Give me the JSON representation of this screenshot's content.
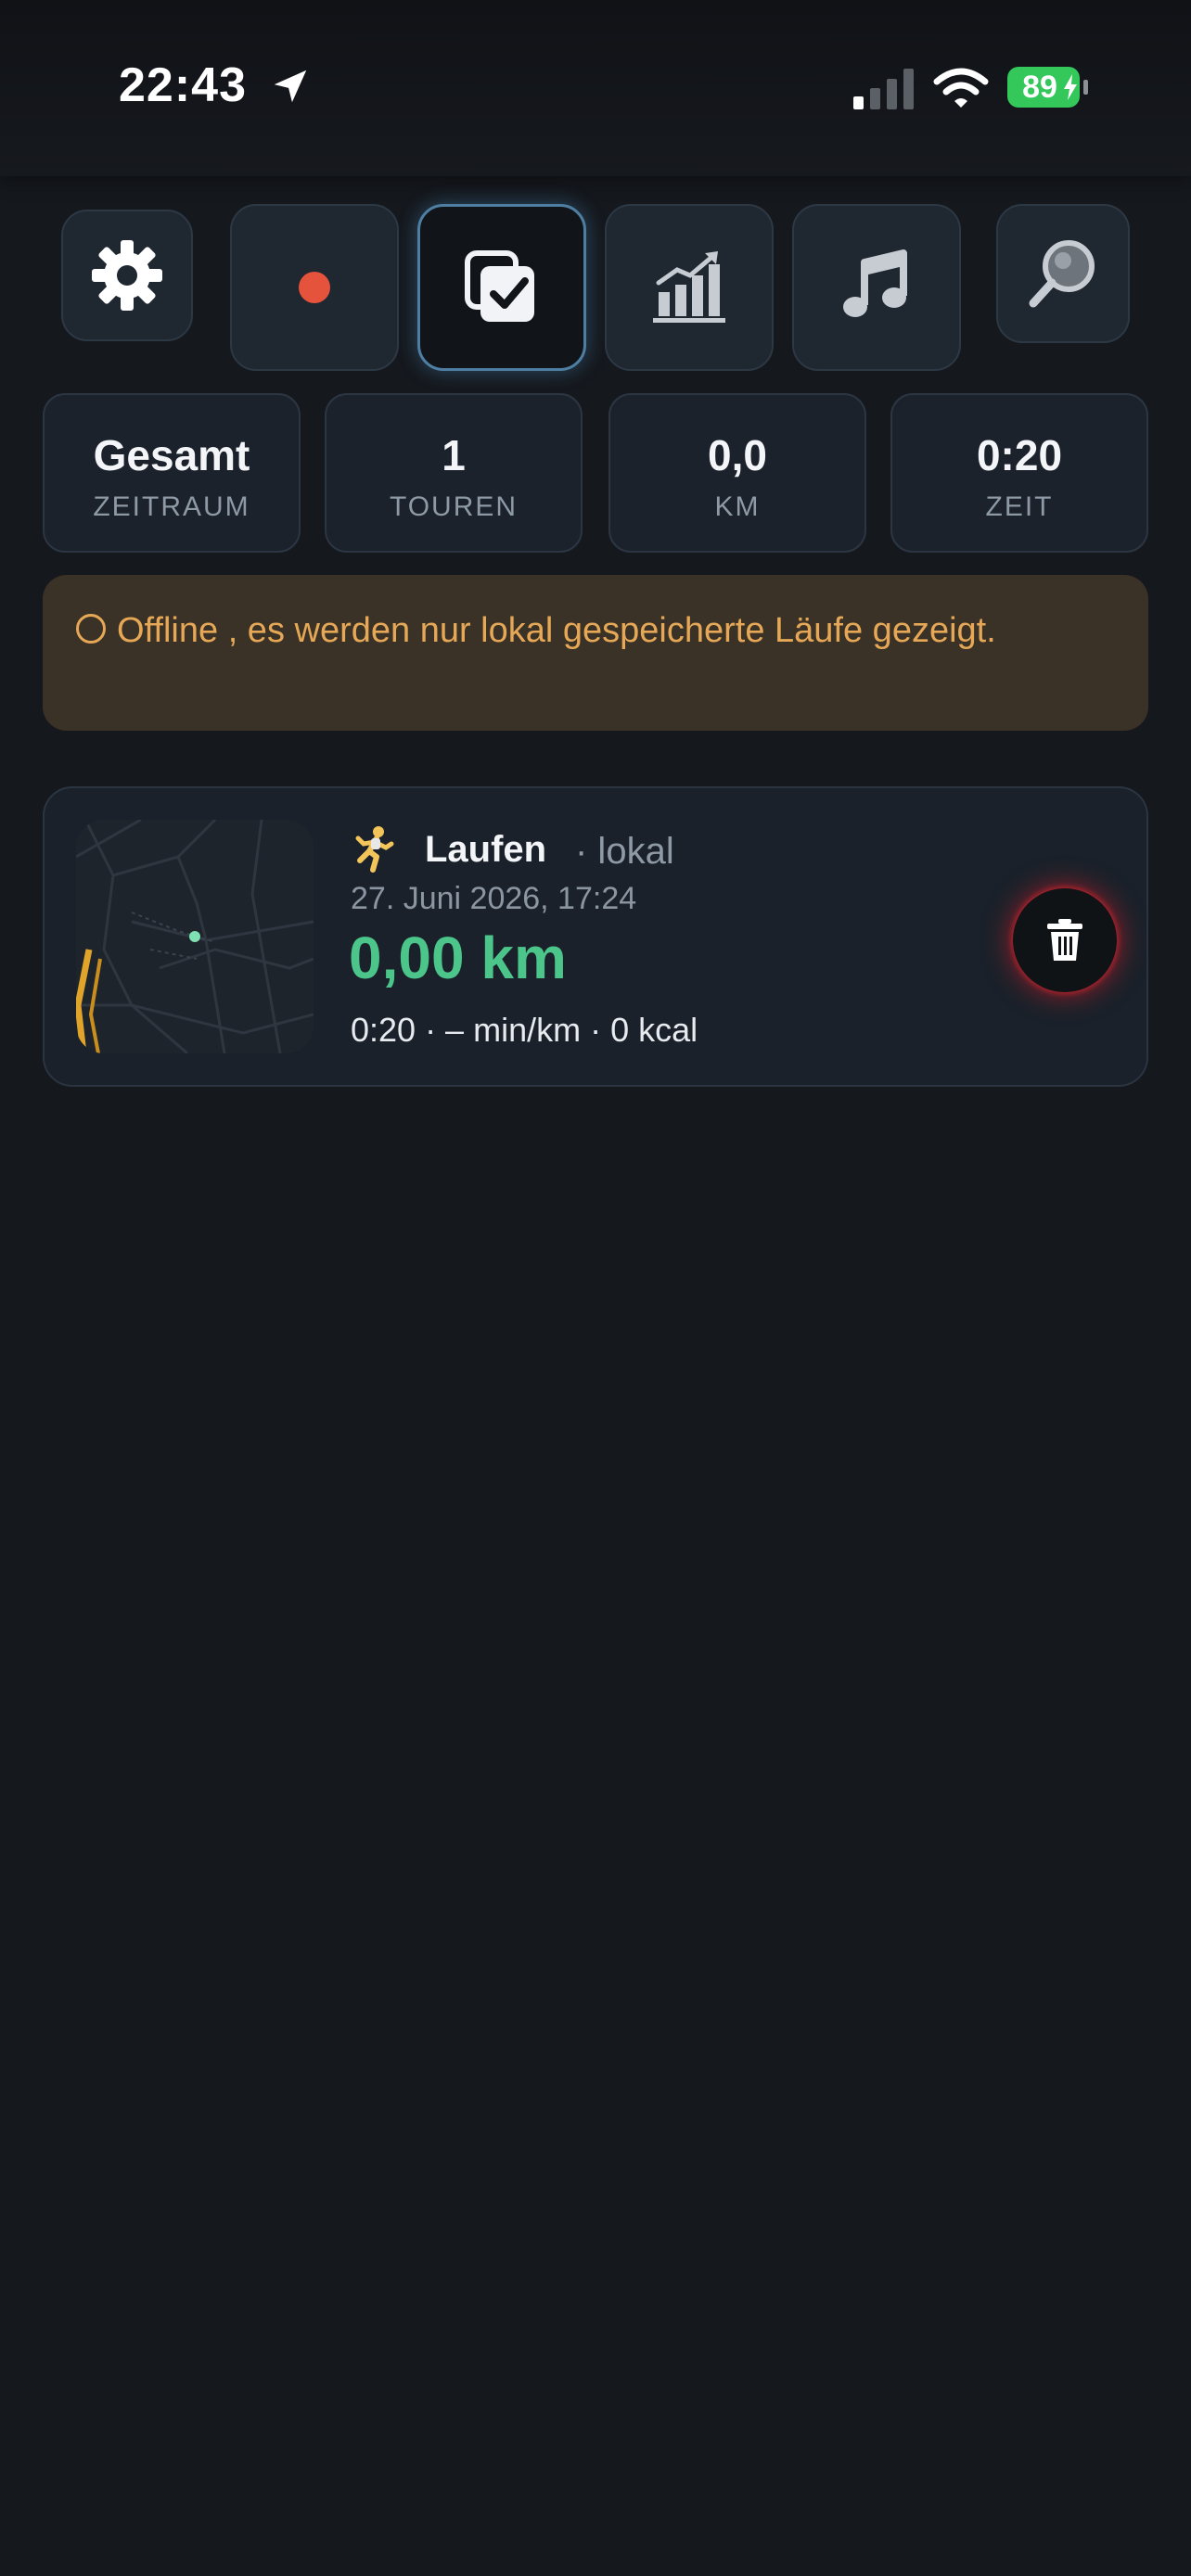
{
  "status_bar": {
    "time": "22:43",
    "battery": "89"
  },
  "toolbar": {
    "icons": [
      "gear-icon",
      "record-icon",
      "checklist-icon",
      "chart-icon",
      "music-icon",
      "search-icon"
    ],
    "active": "checklist-icon",
    "record_color": "#e5533d"
  },
  "stats": {
    "period": {
      "value": "Gesamt",
      "label": "ZEITRAUM"
    },
    "tours": {
      "value": "1",
      "label": "TOUREN"
    },
    "distance": {
      "value": "0,0",
      "label": "KM"
    },
    "time": {
      "value": "0:20",
      "label": "ZEIT"
    }
  },
  "banner": {
    "text": "Offline , es werden nur lokal gespeicherte Läufe gezeigt.",
    "color": "#e6a857"
  },
  "runs": [
    {
      "emoji": "🏃",
      "activity": "Laufen",
      "source": "· lokal",
      "date": "27. Juni 2026, 17:24",
      "distance": "0,00 km",
      "details": "0:20 · – min/km · 0 kcal",
      "distance_color": "#4cc58a"
    }
  ]
}
